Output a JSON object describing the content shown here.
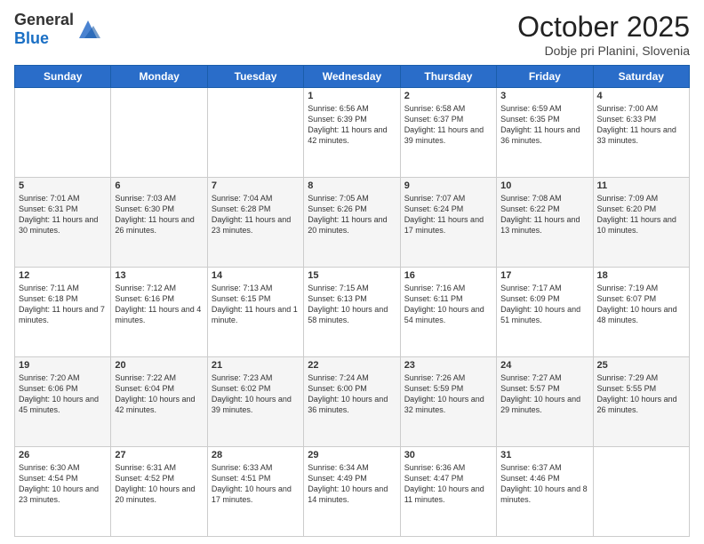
{
  "header": {
    "logo_general": "General",
    "logo_blue": "Blue",
    "month_title": "October 2025",
    "location": "Dobje pri Planini, Slovenia"
  },
  "days_of_week": [
    "Sunday",
    "Monday",
    "Tuesday",
    "Wednesday",
    "Thursday",
    "Friday",
    "Saturday"
  ],
  "weeks": [
    {
      "shade": "white",
      "days": [
        {
          "num": "",
          "content": ""
        },
        {
          "num": "",
          "content": ""
        },
        {
          "num": "",
          "content": ""
        },
        {
          "num": "1",
          "content": "Sunrise: 6:56 AM\nSunset: 6:39 PM\nDaylight: 11 hours and 42 minutes."
        },
        {
          "num": "2",
          "content": "Sunrise: 6:58 AM\nSunset: 6:37 PM\nDaylight: 11 hours and 39 minutes."
        },
        {
          "num": "3",
          "content": "Sunrise: 6:59 AM\nSunset: 6:35 PM\nDaylight: 11 hours and 36 minutes."
        },
        {
          "num": "4",
          "content": "Sunrise: 7:00 AM\nSunset: 6:33 PM\nDaylight: 11 hours and 33 minutes."
        }
      ]
    },
    {
      "shade": "shaded",
      "days": [
        {
          "num": "5",
          "content": "Sunrise: 7:01 AM\nSunset: 6:31 PM\nDaylight: 11 hours and 30 minutes."
        },
        {
          "num": "6",
          "content": "Sunrise: 7:03 AM\nSunset: 6:30 PM\nDaylight: 11 hours and 26 minutes."
        },
        {
          "num": "7",
          "content": "Sunrise: 7:04 AM\nSunset: 6:28 PM\nDaylight: 11 hours and 23 minutes."
        },
        {
          "num": "8",
          "content": "Sunrise: 7:05 AM\nSunset: 6:26 PM\nDaylight: 11 hours and 20 minutes."
        },
        {
          "num": "9",
          "content": "Sunrise: 7:07 AM\nSunset: 6:24 PM\nDaylight: 11 hours and 17 minutes."
        },
        {
          "num": "10",
          "content": "Sunrise: 7:08 AM\nSunset: 6:22 PM\nDaylight: 11 hours and 13 minutes."
        },
        {
          "num": "11",
          "content": "Sunrise: 7:09 AM\nSunset: 6:20 PM\nDaylight: 11 hours and 10 minutes."
        }
      ]
    },
    {
      "shade": "white",
      "days": [
        {
          "num": "12",
          "content": "Sunrise: 7:11 AM\nSunset: 6:18 PM\nDaylight: 11 hours and 7 minutes."
        },
        {
          "num": "13",
          "content": "Sunrise: 7:12 AM\nSunset: 6:16 PM\nDaylight: 11 hours and 4 minutes."
        },
        {
          "num": "14",
          "content": "Sunrise: 7:13 AM\nSunset: 6:15 PM\nDaylight: 11 hours and 1 minute."
        },
        {
          "num": "15",
          "content": "Sunrise: 7:15 AM\nSunset: 6:13 PM\nDaylight: 10 hours and 58 minutes."
        },
        {
          "num": "16",
          "content": "Sunrise: 7:16 AM\nSunset: 6:11 PM\nDaylight: 10 hours and 54 minutes."
        },
        {
          "num": "17",
          "content": "Sunrise: 7:17 AM\nSunset: 6:09 PM\nDaylight: 10 hours and 51 minutes."
        },
        {
          "num": "18",
          "content": "Sunrise: 7:19 AM\nSunset: 6:07 PM\nDaylight: 10 hours and 48 minutes."
        }
      ]
    },
    {
      "shade": "shaded",
      "days": [
        {
          "num": "19",
          "content": "Sunrise: 7:20 AM\nSunset: 6:06 PM\nDaylight: 10 hours and 45 minutes."
        },
        {
          "num": "20",
          "content": "Sunrise: 7:22 AM\nSunset: 6:04 PM\nDaylight: 10 hours and 42 minutes."
        },
        {
          "num": "21",
          "content": "Sunrise: 7:23 AM\nSunset: 6:02 PM\nDaylight: 10 hours and 39 minutes."
        },
        {
          "num": "22",
          "content": "Sunrise: 7:24 AM\nSunset: 6:00 PM\nDaylight: 10 hours and 36 minutes."
        },
        {
          "num": "23",
          "content": "Sunrise: 7:26 AM\nSunset: 5:59 PM\nDaylight: 10 hours and 32 minutes."
        },
        {
          "num": "24",
          "content": "Sunrise: 7:27 AM\nSunset: 5:57 PM\nDaylight: 10 hours and 29 minutes."
        },
        {
          "num": "25",
          "content": "Sunrise: 7:29 AM\nSunset: 5:55 PM\nDaylight: 10 hours and 26 minutes."
        }
      ]
    },
    {
      "shade": "white",
      "days": [
        {
          "num": "26",
          "content": "Sunrise: 6:30 AM\nSunset: 4:54 PM\nDaylight: 10 hours and 23 minutes."
        },
        {
          "num": "27",
          "content": "Sunrise: 6:31 AM\nSunset: 4:52 PM\nDaylight: 10 hours and 20 minutes."
        },
        {
          "num": "28",
          "content": "Sunrise: 6:33 AM\nSunset: 4:51 PM\nDaylight: 10 hours and 17 minutes."
        },
        {
          "num": "29",
          "content": "Sunrise: 6:34 AM\nSunset: 4:49 PM\nDaylight: 10 hours and 14 minutes."
        },
        {
          "num": "30",
          "content": "Sunrise: 6:36 AM\nSunset: 4:47 PM\nDaylight: 10 hours and 11 minutes."
        },
        {
          "num": "31",
          "content": "Sunrise: 6:37 AM\nSunset: 4:46 PM\nDaylight: 10 hours and 8 minutes."
        },
        {
          "num": "",
          "content": ""
        }
      ]
    }
  ]
}
